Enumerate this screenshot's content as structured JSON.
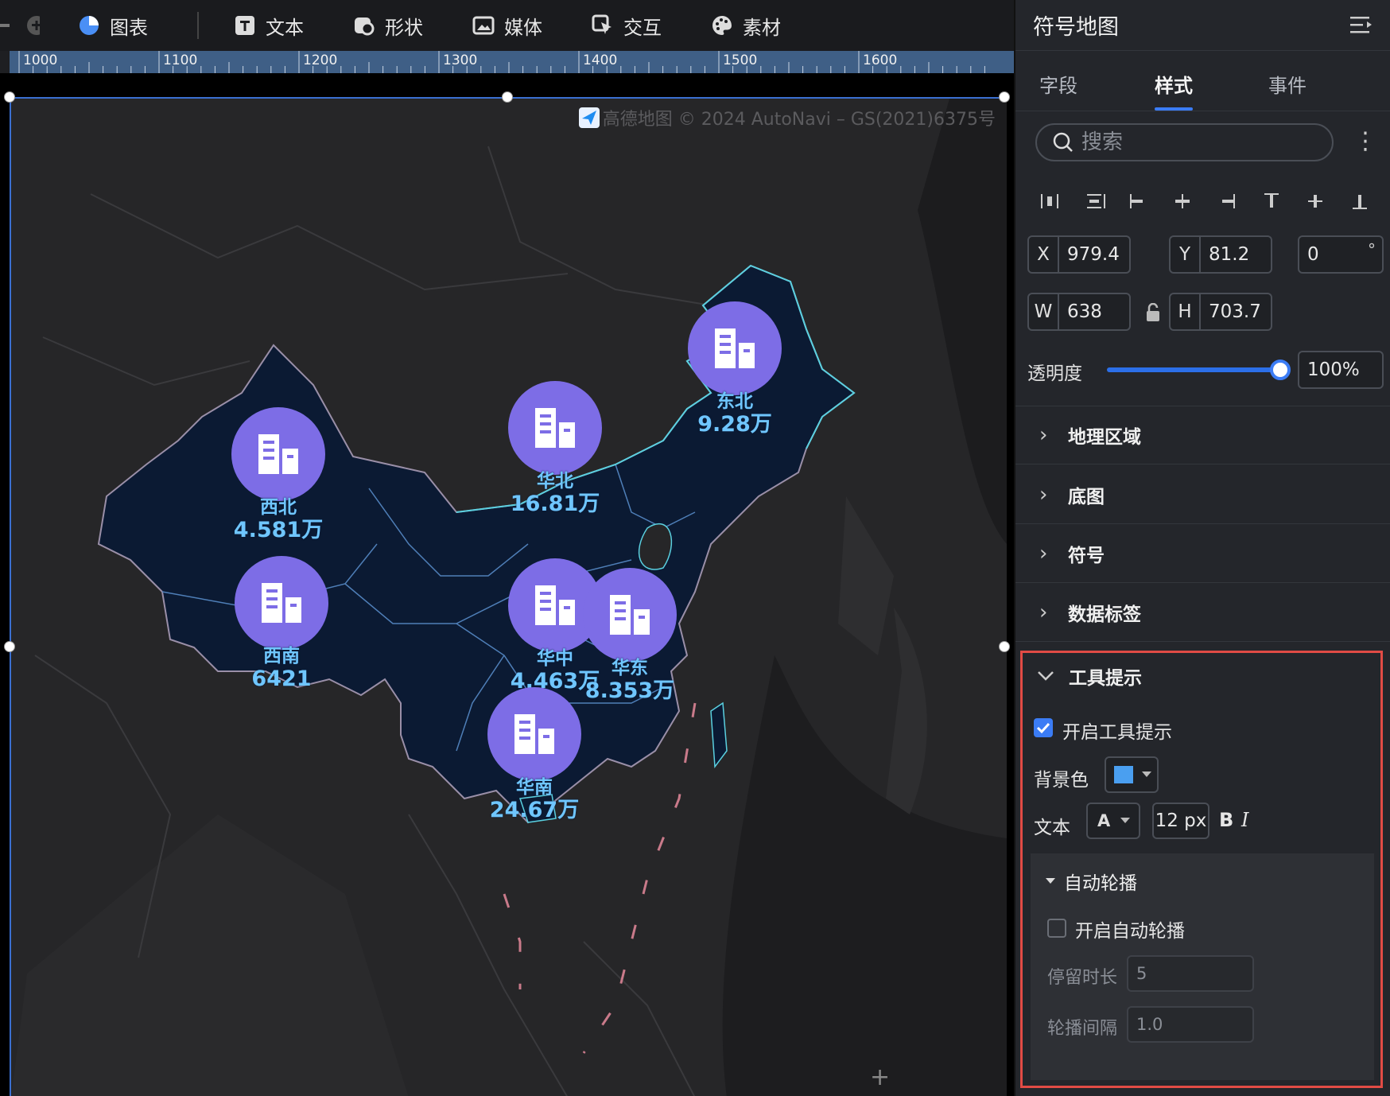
{
  "toolbar": {
    "items": [
      {
        "label": "图表",
        "icon": "chart-pie-icon"
      },
      {
        "label": "文本",
        "icon": "text-icon"
      },
      {
        "label": "形状",
        "icon": "shape-icon"
      },
      {
        "label": "媒体",
        "icon": "media-icon"
      },
      {
        "label": "交互",
        "icon": "interaction-icon"
      },
      {
        "label": "素材",
        "icon": "palette-icon"
      }
    ]
  },
  "ruler": {
    "labels": [
      "1000",
      "1100",
      "1200",
      "1300",
      "1400",
      "1500",
      "1600"
    ]
  },
  "map": {
    "credit": "高德地图 © 2024 AutoNavi – GS(2021)6375号",
    "regions": [
      {
        "name": "东北",
        "value": "9.28万"
      },
      {
        "name": "华北",
        "value": "16.81万"
      },
      {
        "name": "西北",
        "value": "4.581万"
      },
      {
        "name": "西南",
        "value": "6421"
      },
      {
        "name": "华中",
        "value": "4.463万"
      },
      {
        "name": "华东",
        "value": "8.353万"
      },
      {
        "name": "华南",
        "value": "24.67万"
      }
    ],
    "colors": {
      "bubble": "#7d6de6",
      "label": "#6fc6ff",
      "fill": "#0b1a33",
      "border_cn": "#5ad0e0"
    }
  },
  "panel": {
    "title": "符号地图",
    "tabs": [
      "字段",
      "样式",
      "事件"
    ],
    "active_tab": "样式",
    "search_placeholder": "搜索",
    "x": "979.4",
    "y": "81.2",
    "rotation": "0",
    "w": "638",
    "h": "703.7",
    "labels": {
      "x": "X",
      "y": "Y",
      "w": "W",
      "h": "H",
      "deg": "°"
    },
    "opacity_label": "透明度",
    "opacity_value": "100%",
    "sections": [
      "地理区域",
      "底图",
      "符号",
      "数据标签"
    ],
    "tooltip": {
      "title": "工具提示",
      "enable_label": "开启工具提示",
      "enabled": true,
      "bg_label": "背景色",
      "bg_color": "#4a9ff0",
      "text_label": "文本",
      "font_glyph": "A",
      "font_size": "12 px",
      "bold": "B",
      "italic": "I",
      "autoplay": {
        "title": "自动轮播",
        "enable_label": "开启自动轮播",
        "enabled": false,
        "dwell_label": "停留时长",
        "dwell_value": "5",
        "interval_label": "轮播间隔",
        "interval_value": "1.0"
      }
    },
    "accent": "#3b7cf5",
    "highlight": "#e14b45"
  }
}
